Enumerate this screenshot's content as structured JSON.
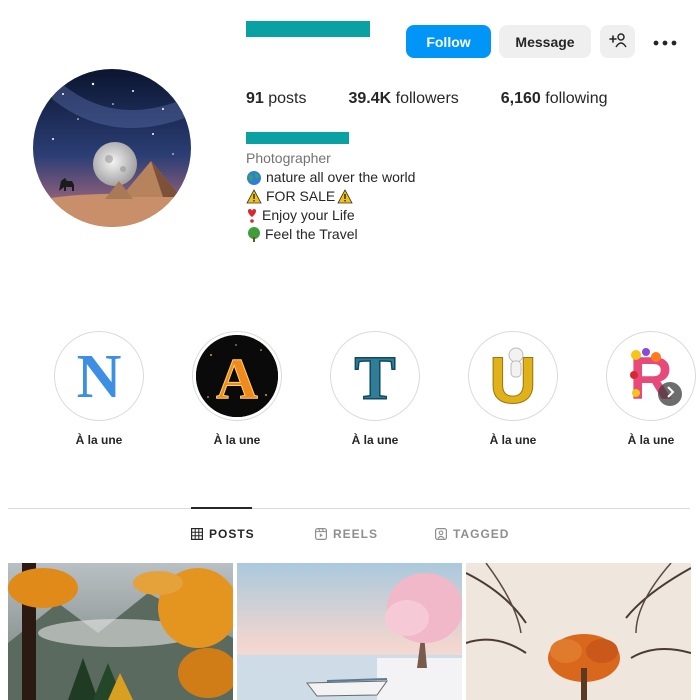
{
  "header": {
    "follow_label": "Follow",
    "message_label": "Message",
    "add_user_icon": "add-person-icon",
    "more_icon": "more-options-icon"
  },
  "stats": [
    {
      "value": "91",
      "label": " posts"
    },
    {
      "value": "39.4K",
      "label": " followers"
    },
    {
      "value": "6,160",
      "label": " following"
    }
  ],
  "bio": {
    "category": "Photographer",
    "lines": [
      {
        "icon": "globe-icon",
        "text": " nature all over the world"
      },
      {
        "icon": "warning-icon",
        "text": " FOR SALE ",
        "trail_icon": "warning-icon"
      },
      {
        "icon": "heart-exclamation-icon",
        "text": "Enjoy your Life"
      },
      {
        "icon": "tree-icon",
        "text": "Feel the Travel"
      }
    ]
  },
  "highlights": [
    {
      "letter": "N",
      "label": "À la une"
    },
    {
      "letter": "A",
      "label": "À la une"
    },
    {
      "letter": "T",
      "label": "À la une"
    },
    {
      "letter": "U",
      "label": "À la une"
    },
    {
      "letter": "R",
      "label": "À la une"
    }
  ],
  "tabs": [
    {
      "label": "POSTS",
      "icon": "grid-icon",
      "active": true
    },
    {
      "label": "REELS",
      "icon": "reels-icon",
      "active": false
    },
    {
      "label": "TAGGED",
      "icon": "tagged-icon",
      "active": false
    }
  ],
  "colors": {
    "accent": "#0095f6",
    "redacted": "#0aa1a2"
  }
}
